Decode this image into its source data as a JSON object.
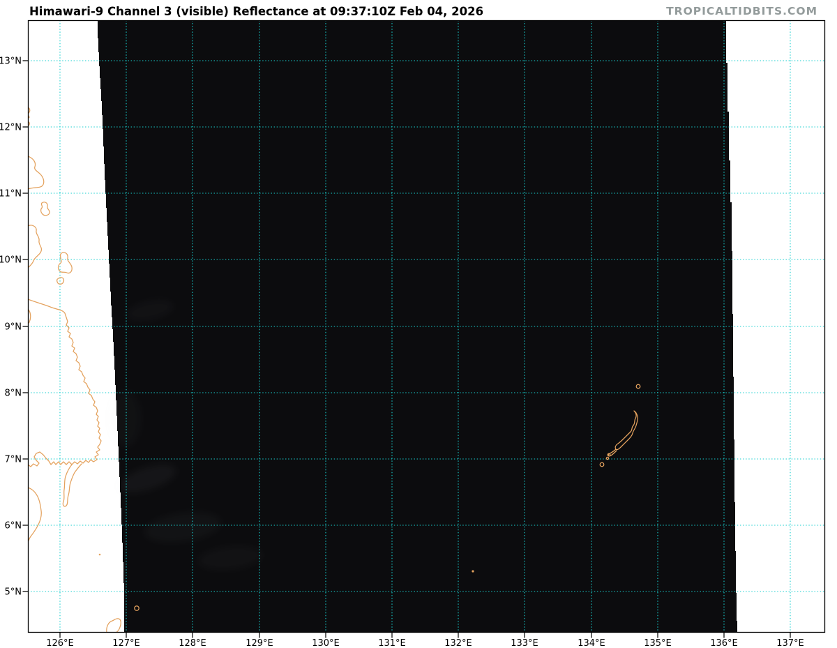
{
  "header": {
    "title": "Himawari-9 Channel 3 (visible) Reflectance at 09:37:10Z Feb 04, 2026",
    "watermark": "TROPICALTIDBITS.COM"
  },
  "colors": {
    "satellite_dark": "#0c0c0e",
    "gridline": "#18cfcf",
    "coastline": "#e4a25e",
    "watermark_text": "#939b9b",
    "plot_background": "#ffffff"
  },
  "axes": {
    "lat_labels": [
      "13°N",
      "12°N",
      "11°N",
      "10°N",
      "9°N",
      "8°N",
      "7°N",
      "6°N",
      "5°N"
    ],
    "lon_labels": [
      "126°E",
      "127°E",
      "128°E",
      "129°E",
      "130°E",
      "131°E",
      "132°E",
      "133°E",
      "134°E",
      "135°E",
      "136°E",
      "137°E"
    ],
    "lat_range": [
      "5°N",
      "13°N"
    ],
    "lon_range": [
      "126°E",
      "137°E"
    ]
  }
}
